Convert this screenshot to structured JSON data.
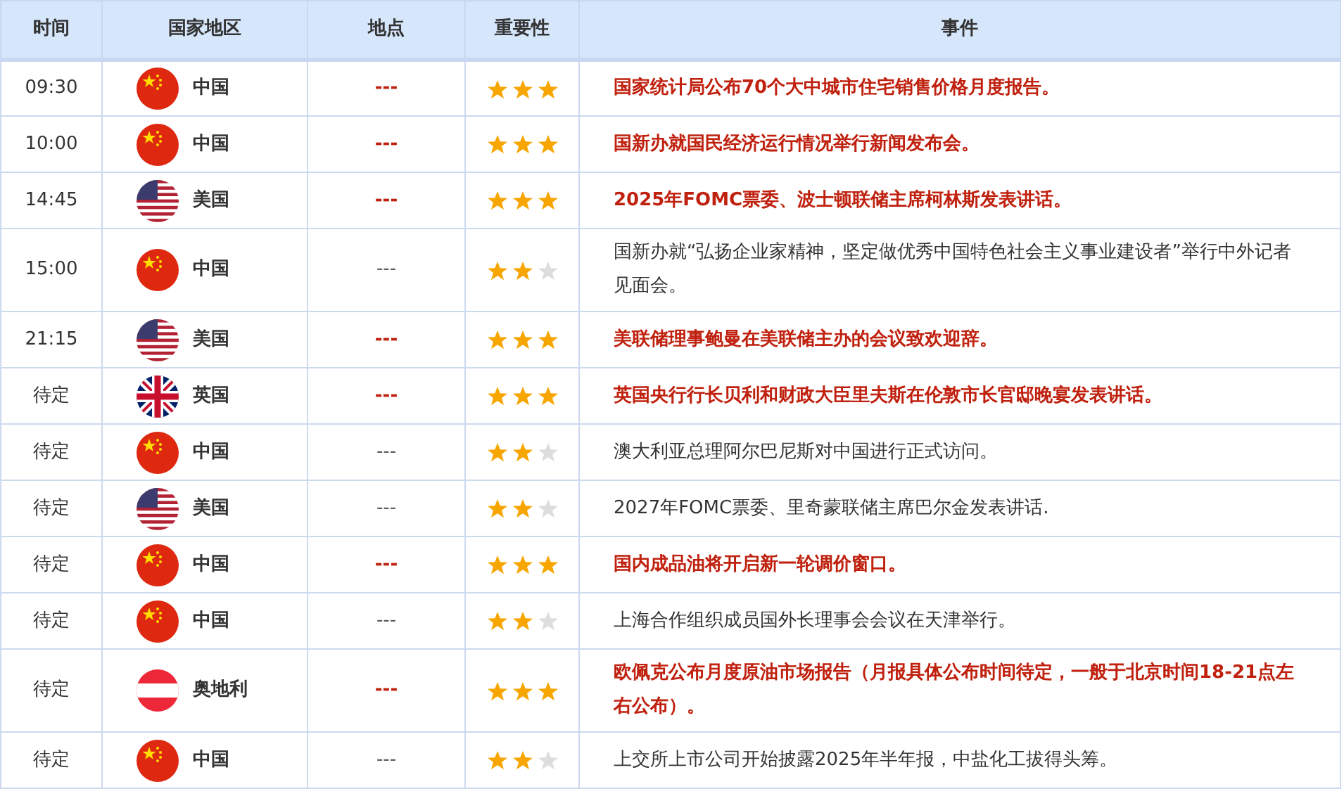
{
  "columns": [
    "时间",
    "国家地区",
    "地点",
    "重要性",
    "事件"
  ],
  "rows": [
    {
      "time": "09:30",
      "kind": "cn",
      "country": "中国",
      "place": "---",
      "stars": 3,
      "highlighted": true,
      "event": "国家统计局公布70个大中城市住宅销售价格月度报告。"
    },
    {
      "time": "10:00",
      "kind": "cn",
      "country": "中国",
      "place": "---",
      "stars": 3,
      "highlighted": true,
      "event": "国新办就国民经济运行情况举行新闻发布会。"
    },
    {
      "time": "14:45",
      "kind": "us",
      "country": "美国",
      "place": "---",
      "stars": 3,
      "highlighted": true,
      "event": "2025年FOMC票委、波士顿联储主席柯林斯发表讲话。"
    },
    {
      "time": "15:00",
      "kind": "cn",
      "country": "中国",
      "place": "---",
      "stars": 2,
      "highlighted": false,
      "event": "国新办就“弘扬企业家精神，坚定做优秀中国特色社会主义事业建设者”举行中外记者见面会。"
    },
    {
      "time": "21:15",
      "kind": "us",
      "country": "美国",
      "place": "---",
      "stars": 3,
      "highlighted": true,
      "event": "美联储理事鲍曼在美联储主办的会议致欢迎辞。"
    },
    {
      "time": "待定",
      "kind": "gb",
      "country": "英国",
      "place": "---",
      "stars": 3,
      "highlighted": true,
      "event": "英国央行行长贝利和财政大臣里夫斯在伦敦市长官邸晚宴发表讲话。"
    },
    {
      "time": "待定",
      "kind": "cn",
      "country": "中国",
      "place": "---",
      "stars": 2,
      "highlighted": false,
      "event": "澳大利亚总理阿尔巴尼斯对中国进行正式访问。"
    },
    {
      "time": "待定",
      "kind": "us",
      "country": "美国",
      "place": "---",
      "stars": 2,
      "highlighted": false,
      "event": "2027年FOMC票委、里奇蒙联储主席巴尔金发表讲话."
    },
    {
      "time": "待定",
      "kind": "cn",
      "country": "中国",
      "place": "---",
      "stars": 3,
      "highlighted": true,
      "event": "国内成品油将开启新一轮调价窗口。"
    },
    {
      "time": "待定",
      "kind": "cn",
      "country": "中国",
      "place": "---",
      "stars": 2,
      "highlighted": false,
      "event": "上海合作组织成员国外长理事会会议在天津举行。"
    },
    {
      "time": "待定",
      "kind": "at",
      "country": "奥地利",
      "place": "---",
      "stars": 3,
      "highlighted": true,
      "event": "欧佩克公布月度原油市场报告（月报具体公布时间待定，一般于北京时间18-21点左右公布）。"
    },
    {
      "time": "待定",
      "kind": "cn",
      "country": "中国",
      "place": "---",
      "stars": 2,
      "highlighted": false,
      "event": "上交所上市公司开始披露2025年半年报，中盐化工拔得头筹。"
    }
  ]
}
